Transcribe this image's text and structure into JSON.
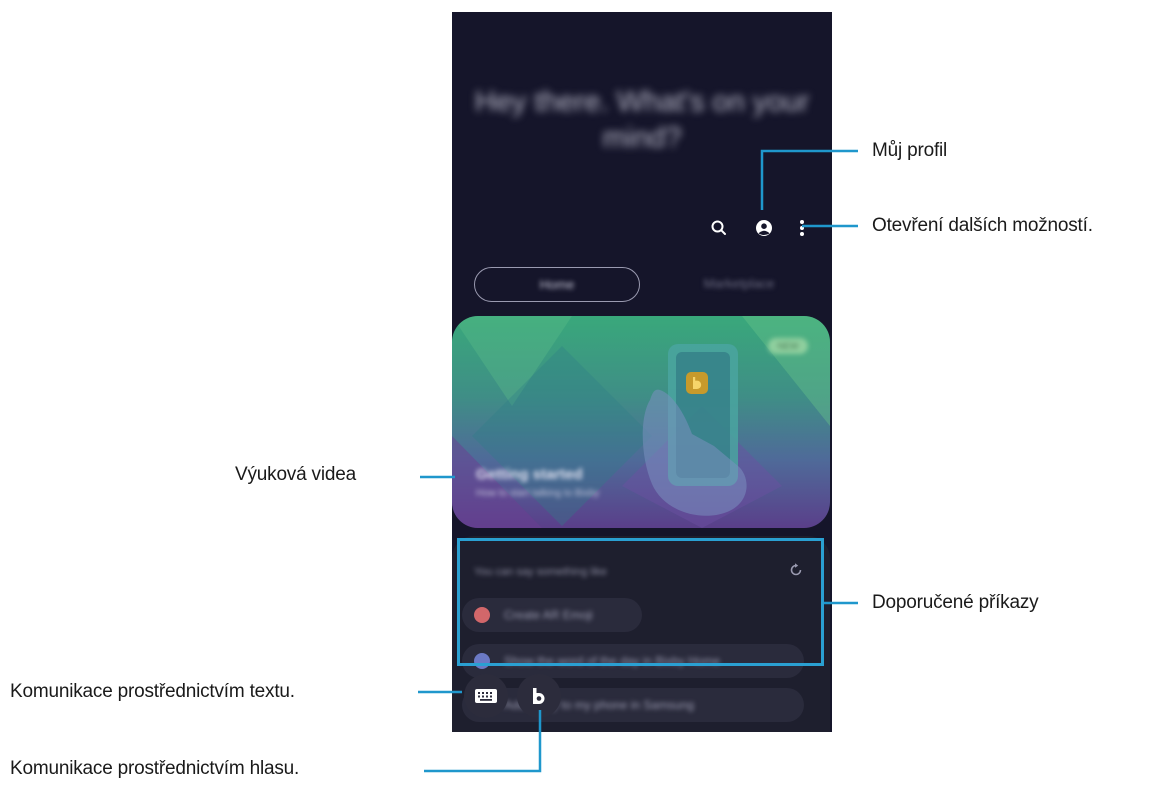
{
  "app": {
    "greeting": "Hey there. What's on your mind?",
    "tabs": [
      {
        "label": "Home"
      },
      {
        "label": "Marketplace"
      }
    ],
    "tutorial_card": {
      "badge": "NEW",
      "title": "Getting started",
      "subtitle": "How to start talking to Bixby"
    },
    "suggestions": {
      "hint": "You can say something like",
      "items": [
        {
          "label": "Create AR Emoji"
        },
        {
          "label": "Show the word of the day in Bixby Home"
        },
        {
          "label": "Add Bixby to my phone in Samsung"
        }
      ]
    }
  },
  "callouts": {
    "profile": "Můj profil",
    "more_options": "Otevření dalších možností.",
    "tutorial_videos": "Výuková videa",
    "suggested_commands": "Doporučené příkazy",
    "text_communication": "Komunikace prostřednictvím textu.",
    "voice_communication": "Komunikace prostřednictvím hlasu."
  },
  "colors": {
    "callout_line": "#1f97cc",
    "phone_bg": "#15152a",
    "highlight": "#2aa0d2"
  }
}
